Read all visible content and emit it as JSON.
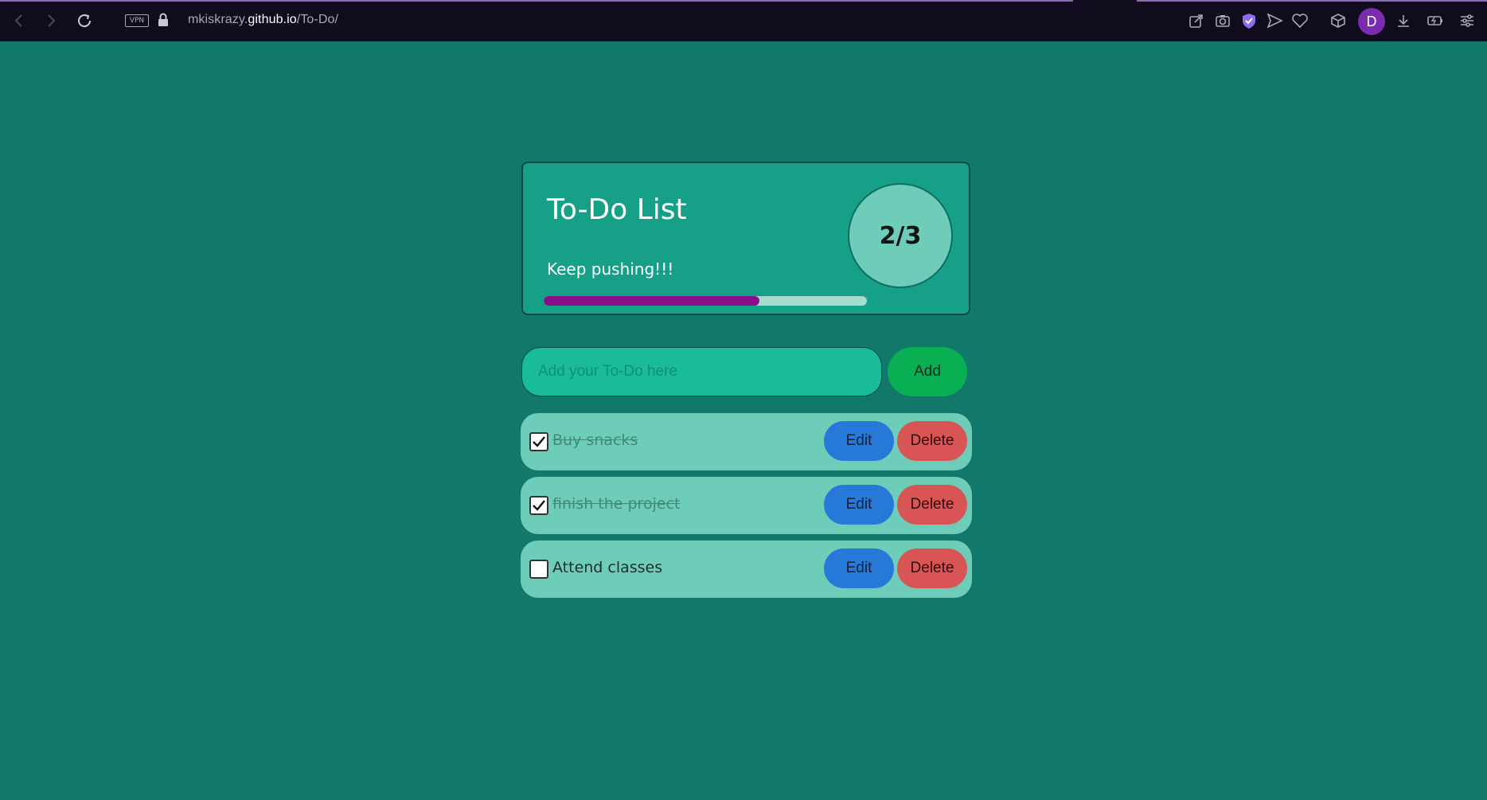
{
  "browser": {
    "url_prefix": "mkiskrazy.",
    "url_host": "github.io",
    "url_path": "/To-Do/",
    "vpn_label": "VPN",
    "profile_initial": "D",
    "icons": [
      "back-icon",
      "forward-icon",
      "reload-icon",
      "lock-icon",
      "share-icon",
      "camera-icon",
      "shield-icon",
      "send-icon",
      "heart-icon",
      "cube-icon",
      "download-icon",
      "battery-icon",
      "settings-icon"
    ]
  },
  "header": {
    "title": "To-Do List",
    "subtitle": "Keep pushing!!!",
    "counter": "2/3",
    "progress": 0.667,
    "progress_color": "#8a0e8a"
  },
  "input": {
    "placeholder": "Add your To-Do here",
    "value": "",
    "add_label": "Add"
  },
  "todos": [
    {
      "text": "Buy snacks",
      "done": true,
      "edit_label": "Edit",
      "delete_label": "Delete"
    },
    {
      "text": "finish the project",
      "done": true,
      "edit_label": "Edit",
      "delete_label": "Delete"
    },
    {
      "text": "Attend classes",
      "done": false,
      "edit_label": "Edit",
      "delete_label": "Delete"
    }
  ],
  "colors": {
    "background": "#12796a",
    "card": "#16a088",
    "item": "#6dcdb8",
    "edit": "#2679d6",
    "delete": "#d95454",
    "add": "#0aae53"
  }
}
